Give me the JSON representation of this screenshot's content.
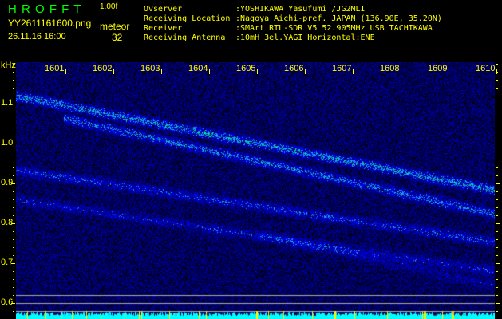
{
  "app": {
    "title": "H R O F F T",
    "version": "1.00f",
    "filename": "YY2611161600.png",
    "datetime": "26.11.16 16:00",
    "meteor_label": "meteor",
    "meteor_count": "32"
  },
  "info": [
    {
      "label": "Ovserver",
      "value": ":YOSHIKAWA Yasufumi /JG2MLI"
    },
    {
      "label": "Receiving Location",
      "value": ":Nagoya Aichi-pref. JAPAN (136.90E, 35.20N)"
    },
    {
      "label": "Receiver",
      "value": ":SMArt RTL-SDR V5 52.905MHz USB TACHIKAWA"
    },
    {
      "label": "Receiving Antenna",
      "value": ":10mH 3el.YAGI Horizontal:ENE"
    }
  ],
  "axis": {
    "unit": "kHz",
    "y_labels": [
      "1.1",
      "1.0",
      "0.9",
      "0.8",
      "0.7",
      "0.6"
    ],
    "y_values": [
      1.1,
      1.0,
      0.9,
      0.8,
      0.7,
      0.6
    ],
    "x_labels": [
      "1601",
      "1602",
      "1603",
      "1604",
      "1605",
      "1606",
      "1607",
      "1608",
      "1609",
      "1610"
    ]
  },
  "colors": {
    "title": "#00ff00",
    "info": "#ffff00",
    "axis": "#ffff00",
    "level": "#00ffff"
  }
}
